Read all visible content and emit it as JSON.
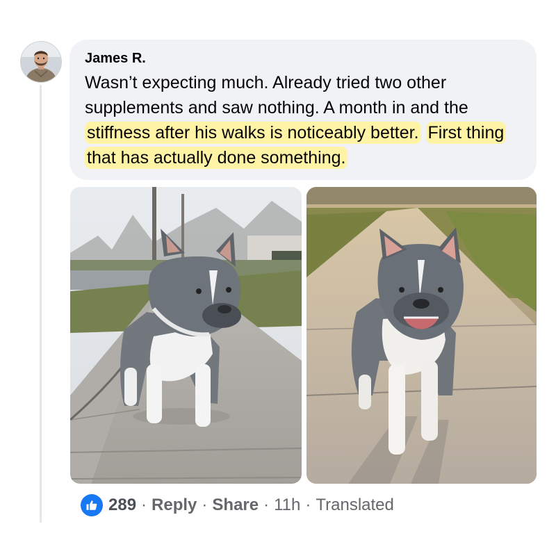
{
  "comment": {
    "author": "James R.",
    "segments": [
      {
        "text": "Wasn’t expecting much. Already tried two other supplements and saw nothing. A month in and the ",
        "highlight": false
      },
      {
        "text": "stiffness after his walks is noticeably better.",
        "highlight": true
      },
      {
        "text": " ",
        "highlight": false
      },
      {
        "text": "First thing that has actually done something.",
        "highlight": true
      }
    ],
    "highlight_color": "#fff3a6",
    "bubble_color": "#f0f2f5"
  },
  "avatar": {
    "icon": "user-avatar-photo"
  },
  "photos": [
    {
      "icon": "french-bulldog-photo-street"
    },
    {
      "icon": "french-bulldog-photo-sunset"
    }
  ],
  "actions": {
    "reaction_icon": "thumbs-up-icon",
    "reaction_color": "#1877f2",
    "reaction_count": "289",
    "separator": "·",
    "reply_label": "Reply",
    "share_label": "Share",
    "time": "11h",
    "translated_label": "Translated"
  }
}
